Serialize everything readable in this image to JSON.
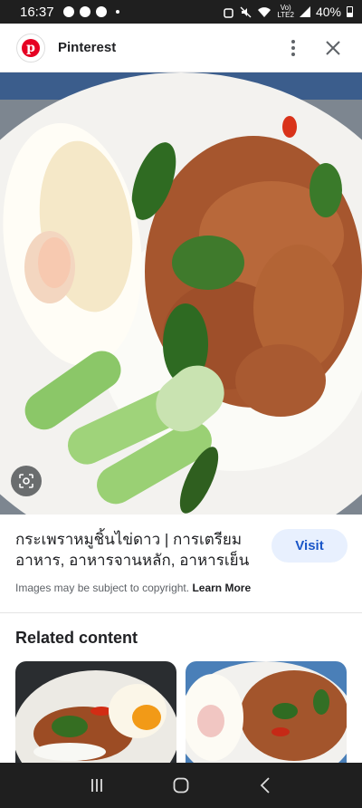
{
  "status_bar": {
    "time": "16:37",
    "network_top": "Vo)",
    "network_bottom": "LTE2",
    "battery": "40%"
  },
  "header": {
    "site_name": "Pinterest"
  },
  "caption": {
    "title": "กระเพราหมูชิ้นไข่ดาว | การเตรียมอาหาร, อาหารจานหลัก, อาหารเย็น",
    "visit_label": "Visit",
    "copyright_text": "Images may be subject to copyright.",
    "learn_more": "Learn More"
  },
  "related": {
    "title": "Related content"
  }
}
